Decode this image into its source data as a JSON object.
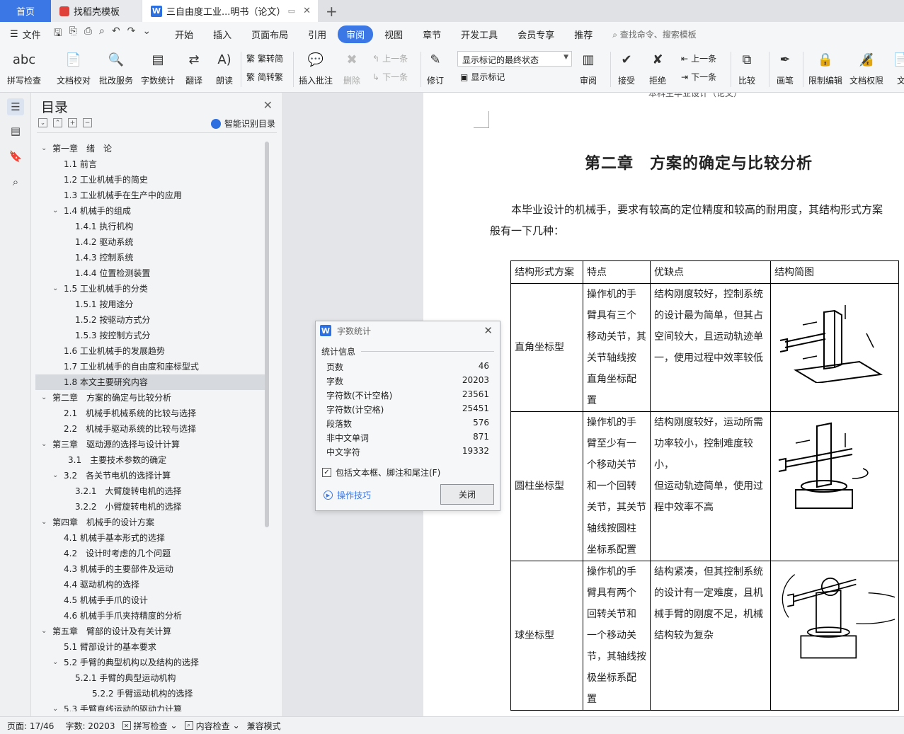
{
  "tabs": {
    "home": "首页",
    "template": "找稻壳模板",
    "doc": "三自由度工业...明书（论文）"
  },
  "menubar": {
    "file": "文件",
    "items": [
      "开始",
      "插入",
      "页面布局",
      "引用",
      "审阅",
      "视图",
      "章节",
      "开发工具",
      "会员专享",
      "推荐"
    ],
    "active_index": 4,
    "search": "查找命令、搜索模板"
  },
  "ribbon": {
    "spell_check": "拼写检查",
    "doc_proof": "文档校对",
    "batch_service": "批改服务",
    "word_count": "字数统计",
    "translate": "翻译",
    "read_aloud": "朗读",
    "to_traditional": "繁转简",
    "to_simplified": "简转繁",
    "insert_comment": "插入批注",
    "delete": "删除",
    "prev": "上一条",
    "next": "下一条",
    "track_changes": "修订",
    "markup_dropdown": "显示标记的最终状态",
    "show_markup": "显示标记",
    "review": "审阅",
    "accept": "接受",
    "reject": "拒绝",
    "prev2": "上一条",
    "next2": "下一条",
    "compare": "比较",
    "ink": "画笔",
    "restrict_edit": "限制编辑",
    "doc_rights": "文档权限",
    "cut_label": "文"
  },
  "toc": {
    "title": "目录",
    "smart": "智能识别目录",
    "items": [
      {
        "text": "第一章　绪　论",
        "level": 0,
        "chev": true
      },
      {
        "text": "1.1 前言",
        "level": 1
      },
      {
        "text": "1.2  工业机械手的简史",
        "level": 1
      },
      {
        "text": "1.3 工业机械手在生产中的应用",
        "level": 1
      },
      {
        "text": "1.4  机械手的组成",
        "level": 1,
        "chev": true
      },
      {
        "text": "1.4.1 执行机构",
        "level": 2
      },
      {
        "text": "1.4.2 驱动系统",
        "level": 2
      },
      {
        "text": "1.4.3 控制系统",
        "level": 2
      },
      {
        "text": "1.4.4 位置检测装置",
        "level": 2
      },
      {
        "text": "1.5 工业机械手的分类",
        "level": 1,
        "chev": true
      },
      {
        "text": "1.5.1 按用途分",
        "level": 2
      },
      {
        "text": "1.5.2 按驱动方式分",
        "level": 2
      },
      {
        "text": "1.5.3 按控制方式分",
        "level": 2
      },
      {
        "text": "1.6 工业机械手的发展趋势",
        "level": 1
      },
      {
        "text": "1.7 工业机械手的自由度和座标型式",
        "level": 1
      },
      {
        "text": "1.8 本文主要研究内容",
        "level": 1,
        "selected": true
      },
      {
        "text": "第二章　方案的确定与比较分析",
        "level": 0,
        "chev": true
      },
      {
        "text": "2.1　机械手机械系统的比较与选择",
        "level": 1
      },
      {
        "text": "2.2　机械手驱动系统的比较与选择",
        "level": 1
      },
      {
        "text": "第三章　驱动源的选择与设计计算",
        "level": 0,
        "chev": true
      },
      {
        "text": "3.1　主要技术参数的确定",
        "level": 1.5
      },
      {
        "text": "3.2　各关节电机的选择计算",
        "level": 1,
        "chev": true
      },
      {
        "text": "3.2.1　大臂旋转电机的选择",
        "level": 2
      },
      {
        "text": "3.2.2　小臂旋转电机的选择",
        "level": 2
      },
      {
        "text": "第四章　机械手的设计方案",
        "level": 0,
        "chev": true
      },
      {
        "text": "4.1  机械手基本形式的选择",
        "level": 1
      },
      {
        "text": "4.2　设计时考虑的几个问题",
        "level": 1
      },
      {
        "text": "4.3 机械手的主要部件及运动",
        "level": 1
      },
      {
        "text": "4.4 驱动机构的选择",
        "level": 1
      },
      {
        "text": "4.5 机械手手爪的设计",
        "level": 1
      },
      {
        "text": "4.6  机械手手爪夹持精度的分析",
        "level": 1
      },
      {
        "text": "第五章　臂部的设计及有关计算",
        "level": 0,
        "chev": true
      },
      {
        "text": "5.1  臂部设计的基本要求",
        "level": 1
      },
      {
        "text": "5.2  手臂的典型机构以及结构的选择",
        "level": 1,
        "chev": true
      },
      {
        "text": "5.2.1  手臂的典型运动机构",
        "level": 2
      },
      {
        "text": "5.2.2  手臂运动机构的选择",
        "level": 3
      },
      {
        "text": "5.3  手臂直线运动的驱动力计算",
        "level": 1,
        "chev": true
      }
    ]
  },
  "document": {
    "header": "本科生毕业设计（论文）",
    "chapter_title": "第二章　方案的确定与比较分析",
    "para_line1": "本毕业设计的机械手，要求有较高的定位精度和较高的耐用度，其结构形式方案",
    "para_line2": "般有一下几种：",
    "table": {
      "headers": [
        "结构形式方案",
        "特点",
        "优缺点",
        "结构简图"
      ],
      "rows": [
        {
          "name": "直角坐标型",
          "feature": [
            "操作机的手",
            "臂具有三个",
            "移动关节，其",
            "关节轴线按",
            "直角坐标配",
            "置"
          ],
          "pros": [
            "结构刚度较好，控制系统",
            "的设计最为简单，但其占",
            "空间较大，且运动轨迹单",
            "一，使用过程中效率较低"
          ]
        },
        {
          "name": "圆柱坐标型",
          "feature": [
            "操作机的手",
            "臂至少有一",
            "个移动关节",
            "和一个回转",
            "关节，其关节",
            "轴线按圆柱",
            "坐标系配置"
          ],
          "pros": [
            "结构刚度较好，运动所需",
            "功率较小，控制难度较小，",
            "但运动轨迹简单，使用过",
            "程中效率不高"
          ]
        },
        {
          "name": "球坐标型",
          "feature": [
            "操作机的手",
            "臂具有两个",
            "回转关节和",
            "一个移动关",
            "节，其轴线按",
            "极坐标系配",
            "置"
          ],
          "pros": [
            "结构紧凑，但其控制系统",
            "的设计有一定难度，且机",
            "械手臂的刚度不足，机械",
            "结构较为复杂"
          ]
        }
      ]
    }
  },
  "dialog": {
    "title": "字数统计",
    "section": "统计信息",
    "stats": [
      {
        "label": "页数",
        "value": "46"
      },
      {
        "label": "字数",
        "value": "20203"
      },
      {
        "label": "字符数(不计空格)",
        "value": "23561"
      },
      {
        "label": "字符数(计空格)",
        "value": "25451"
      },
      {
        "label": "段落数",
        "value": "576"
      },
      {
        "label": "非中文单词",
        "value": "871"
      },
      {
        "label": "中文字符",
        "value": "19332"
      }
    ],
    "checkbox": "包括文本框、脚注和尾注(F)",
    "tips": "操作技巧",
    "close": "关闭"
  },
  "statusbar": {
    "page": "页面: 17/46",
    "words": "字数: 20203",
    "spell": "拼写检查",
    "content_check": "内容检查",
    "compat": "兼容模式"
  }
}
